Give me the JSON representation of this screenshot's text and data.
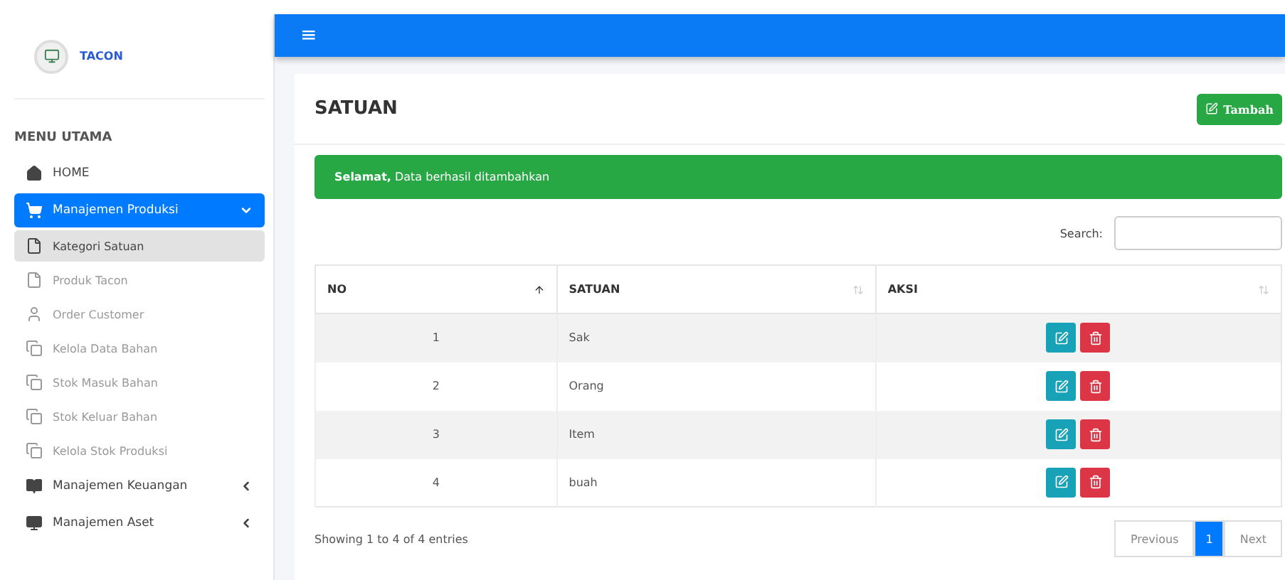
{
  "brand": {
    "name": "TACON"
  },
  "sidebar": {
    "heading": "MENU UTAMA",
    "items": [
      {
        "kind": "link",
        "label": "HOME",
        "selected": false
      },
      {
        "kind": "group",
        "label": "Manajemen Produksi",
        "selected": true,
        "expanded": true,
        "children": [
          {
            "label": "Kategori Satuan",
            "selected": true
          },
          {
            "label": "Produk Tacon",
            "selected": false
          },
          {
            "label": "Order Customer",
            "selected": false
          },
          {
            "label": "Kelola Data Bahan",
            "selected": false
          },
          {
            "label": "Stok Masuk Bahan",
            "selected": false
          },
          {
            "label": "Stok Keluar Bahan",
            "selected": false
          },
          {
            "label": "Kelola Stok Produksi",
            "selected": false
          }
        ]
      },
      {
        "kind": "group",
        "label": "Manajemen Keuangan",
        "selected": false,
        "expanded": false
      },
      {
        "kind": "group",
        "label": "Manajemen Aset",
        "selected": false,
        "expanded": false
      }
    ]
  },
  "navbar": {
    "menu_glyph": "≡"
  },
  "card": {
    "title": "SATUAN",
    "add_button": "Tambah"
  },
  "alert": {
    "text": "**Selamat,** Data berhasil ditambahkan"
  },
  "search": {
    "label": "Search:"
  },
  "table": {
    "columns": [
      {
        "label": "NO",
        "sorted": true
      },
      {
        "label": "SATUAN",
        "sorted": false
      },
      {
        "label": "AKSI",
        "sorted": false
      }
    ],
    "rows": [
      [
        "1",
        "Sak"
      ],
      [
        "2",
        "Orang"
      ],
      [
        "3",
        "Item"
      ],
      [
        "4",
        "buah"
      ]
    ]
  },
  "footer": {
    "info": "Showing 1 to 4 of 4 entries",
    "pages": [
      {
        "label": "Previous",
        "kind": "nav",
        "selected": false
      },
      {
        "label": "1",
        "kind": "page",
        "selected": true
      },
      {
        "label": "Next",
        "kind": "nav",
        "selected": false
      }
    ]
  }
}
